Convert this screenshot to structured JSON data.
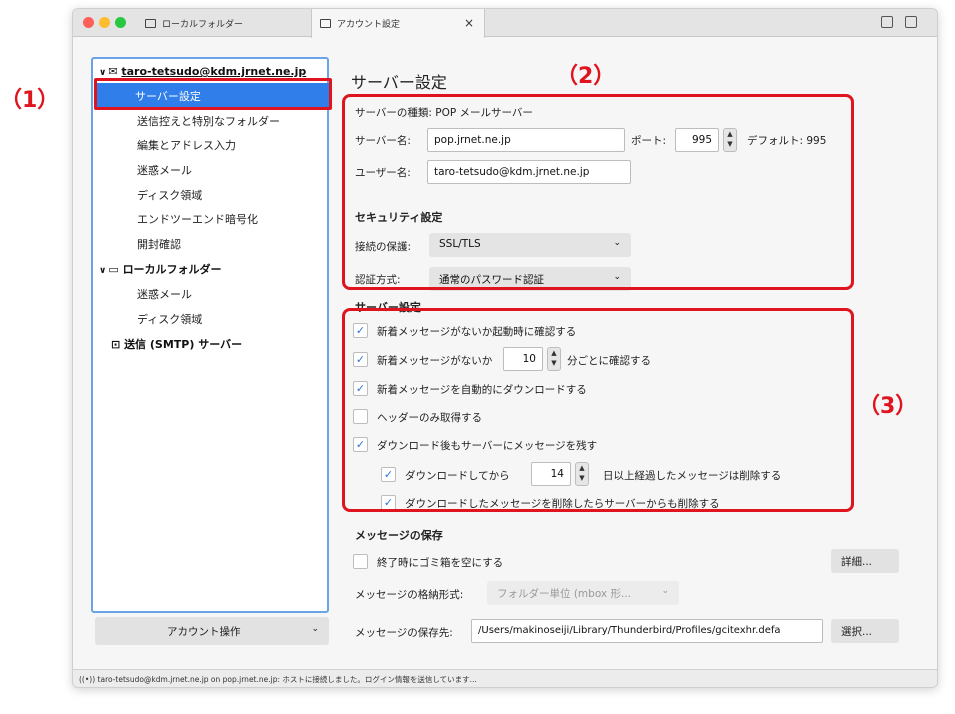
{
  "tabs": {
    "local_folder": "ローカルフォルダー",
    "account_settings": "アカウント設定",
    "close": "×"
  },
  "sidebar": {
    "account": "taro-tetsudo@kdm.jrnet.ne.jp",
    "items": [
      "サーバー設定",
      "送信控えと特別なフォルダー",
      "編集とアドレス入力",
      "迷惑メール",
      "ディスク領域",
      "エンドツーエンド暗号化",
      "開封確認"
    ],
    "local_folder": "ローカルフォルダー",
    "local_items": [
      "迷惑メール",
      "ディスク領域"
    ],
    "smtp": "送信 (SMTP) サーバー",
    "account_ops": "アカウント操作"
  },
  "main": {
    "title": "サーバー設定",
    "server_type": "サーバーの種類: POP メールサーバー",
    "server_name_label": "サーバー名:",
    "server_name": "pop.jrnet.ne.jp",
    "port_label": "ポート:",
    "port": "995",
    "default_label": "デフォルト: 995",
    "user_label": "ユーザー名:",
    "user": "taro-tetsudo@kdm.jrnet.ne.jp",
    "security_title": "セキュリティ設定",
    "conn_label": "接続の保護:",
    "conn_value": "SSL/TLS",
    "auth_label": "認証方式:",
    "auth_value": "通常のパスワード認証",
    "server_settings_title": "サーバー設定",
    "check_startup": "新着メッセージがないか起動時に確認する",
    "check_every_pre": "新着メッセージがないか",
    "check_every_value": "10",
    "check_every_post": "分ごとに確認する",
    "auto_download": "新着メッセージを自動的にダウンロードする",
    "headers_only": "ヘッダーのみ取得する",
    "leave_on_server": "ダウンロード後もサーバーにメッセージを残す",
    "delete_after_pre": "ダウンロードしてから",
    "delete_after_value": "14",
    "delete_after_post": "日以上経過したメッセージは削除する",
    "delete_sync": "ダウンロードしたメッセージを削除したらサーバーからも削除する",
    "storage_title": "メッセージの保存",
    "empty_trash": "終了時にゴミ箱を空にする",
    "details_btn": "詳細...",
    "format_label": "メッセージの格納形式:",
    "format_value": "フォルダー単位 (mbox 形...",
    "path_label": "メッセージの保存先:",
    "path_value": "/Users/makinoseiji/Library/Thunderbird/Profiles/gcitexhr.defa",
    "select_btn": "選択..."
  },
  "status": "taro-tetsudo@kdm.jrnet.ne.jp on pop.jrnet.ne.jp: ホストに接続しました。ログイン情報を送信しています...",
  "callouts": [
    "（1）",
    "（2）",
    "（3）"
  ],
  "colors": {
    "accent": "#2f7ee9",
    "callout": "#e0141e"
  }
}
